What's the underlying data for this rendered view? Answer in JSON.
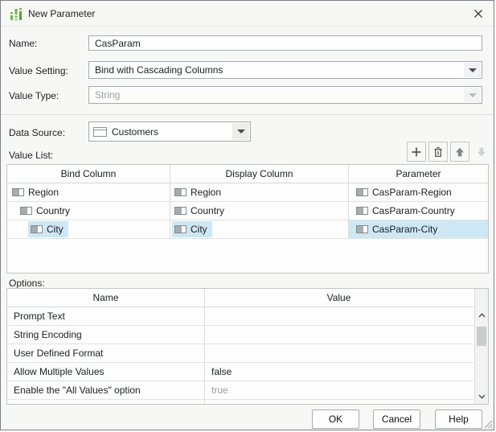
{
  "dialog": {
    "title": "New Parameter"
  },
  "form": {
    "name_label": "Name:",
    "name_value": "CasParam",
    "value_setting_label": "Value Setting:",
    "value_setting_value": "Bind with Cascading Columns",
    "value_type_label": "Value Type:",
    "value_type_value": "String",
    "data_source_label": "Data Source:",
    "data_source_value": "Customers"
  },
  "value_list": {
    "label": "Value List:",
    "toolbar": {
      "add_icon": "plus",
      "delete_icon": "trash",
      "move_up_icon": "arrow-up",
      "move_down_icon": "arrow-down-disabled"
    },
    "headers": [
      "Bind Column",
      "Display Column",
      "Parameter"
    ],
    "rows": [
      {
        "bind": "Region",
        "display": "Region",
        "parameter": "CasParam-Region",
        "indent": 0,
        "selected": false
      },
      {
        "bind": "Country",
        "display": "Country",
        "parameter": "CasParam-Country",
        "indent": 1,
        "selected": false
      },
      {
        "bind": "City",
        "display": "City",
        "parameter": "CasParam-City",
        "indent": 2,
        "selected": true
      }
    ]
  },
  "options": {
    "label": "Options:",
    "headers": {
      "name": "Name",
      "value": "Value"
    },
    "rows": [
      {
        "name": "Prompt Text",
        "value": ""
      },
      {
        "name": "String Encoding",
        "value": ""
      },
      {
        "name": "User Defined Format",
        "value": ""
      },
      {
        "name": "Allow Multiple Values",
        "value": "false"
      },
      {
        "name": "Enable the \"All Values\" option",
        "value": "true"
      }
    ]
  },
  "footer": {
    "ok": "OK",
    "cancel": "Cancel",
    "help": "Help"
  },
  "colors": {
    "selection": "#cde7f5",
    "icon_green": "#6db33f",
    "disabled_text": "#9aa0a4",
    "dialog_bg": "#f7f8f6"
  }
}
